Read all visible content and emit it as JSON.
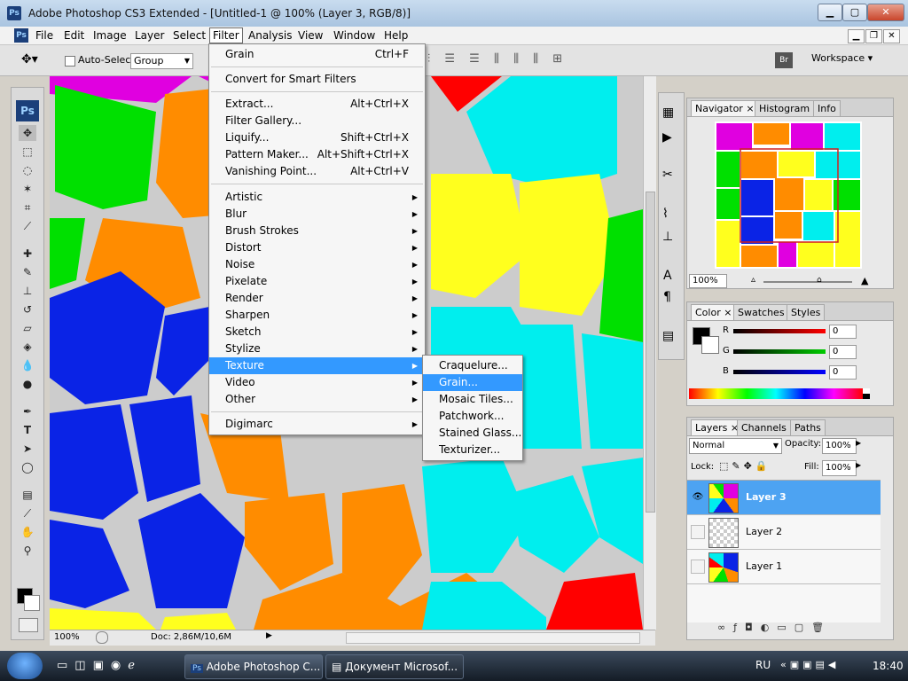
{
  "window": {
    "title": "Adobe Photoshop CS3 Extended - [Untitled-1 @ 100% (Layer 3, RGB/8)]",
    "ps_badge": "Ps"
  },
  "menubar": [
    "File",
    "Edit",
    "Image",
    "Layer",
    "Select",
    "Filter",
    "Analysis",
    "View",
    "Window",
    "Help"
  ],
  "options": {
    "auto_select_label": "Auto-Select:",
    "auto_select_value": "Group",
    "workspace_label": "Workspace"
  },
  "filter_menu": {
    "top": [
      {
        "label": "Grain",
        "shortcut": "Ctrl+F"
      }
    ],
    "smart": [
      {
        "label": "Convert for Smart Filters",
        "shortcut": ""
      }
    ],
    "special": [
      {
        "label": "Extract...",
        "shortcut": "Alt+Ctrl+X"
      },
      {
        "label": "Filter Gallery...",
        "shortcut": ""
      },
      {
        "label": "Liquify...",
        "shortcut": "Shift+Ctrl+X"
      },
      {
        "label": "Pattern Maker...",
        "shortcut": "Alt+Shift+Ctrl+X"
      },
      {
        "label": "Vanishing Point...",
        "shortcut": "Alt+Ctrl+V"
      }
    ],
    "groups": [
      "Artistic",
      "Blur",
      "Brush Strokes",
      "Distort",
      "Noise",
      "Pixelate",
      "Render",
      "Sharpen",
      "Sketch",
      "Stylize",
      "Texture",
      "Video",
      "Other"
    ],
    "bottom": [
      "Digimarc"
    ],
    "highlighted": "Texture"
  },
  "texture_submenu": {
    "items": [
      "Craquelure...",
      "Grain...",
      "Mosaic Tiles...",
      "Patchwork...",
      "Stained Glass...",
      "Texturizer..."
    ],
    "highlighted": "Grain..."
  },
  "status": {
    "zoom": "100%",
    "doc": "Doc: 2,86M/10,6M"
  },
  "navigator": {
    "tabs": [
      "Navigator",
      "Histogram",
      "Info"
    ],
    "zoom": "100%"
  },
  "color_panel": {
    "tabs": [
      "Color",
      "Swatches",
      "Styles"
    ],
    "channels": [
      {
        "label": "R",
        "value": "0"
      },
      {
        "label": "G",
        "value": "0"
      },
      {
        "label": "B",
        "value": "0"
      }
    ]
  },
  "layers_panel": {
    "tabs": [
      "Layers",
      "Channels",
      "Paths"
    ],
    "blend_mode": "Normal",
    "opacity_label": "Opacity:",
    "opacity": "100%",
    "lock_label": "Lock:",
    "fill_label": "Fill:",
    "fill": "100%",
    "layers": [
      {
        "name": "Layer 3",
        "selected": true,
        "visible": true
      },
      {
        "name": "Layer 2",
        "selected": false,
        "visible": false
      },
      {
        "name": "Layer 1",
        "selected": false,
        "visible": false
      }
    ]
  },
  "taskbar": {
    "tasks": [
      "Adobe Photoshop C...",
      "Документ Microsof..."
    ],
    "lang": "RU",
    "time": "18:40"
  },
  "colors": {
    "menu_highlight": "#3399ff",
    "layer_selected": "#4da3f2"
  }
}
